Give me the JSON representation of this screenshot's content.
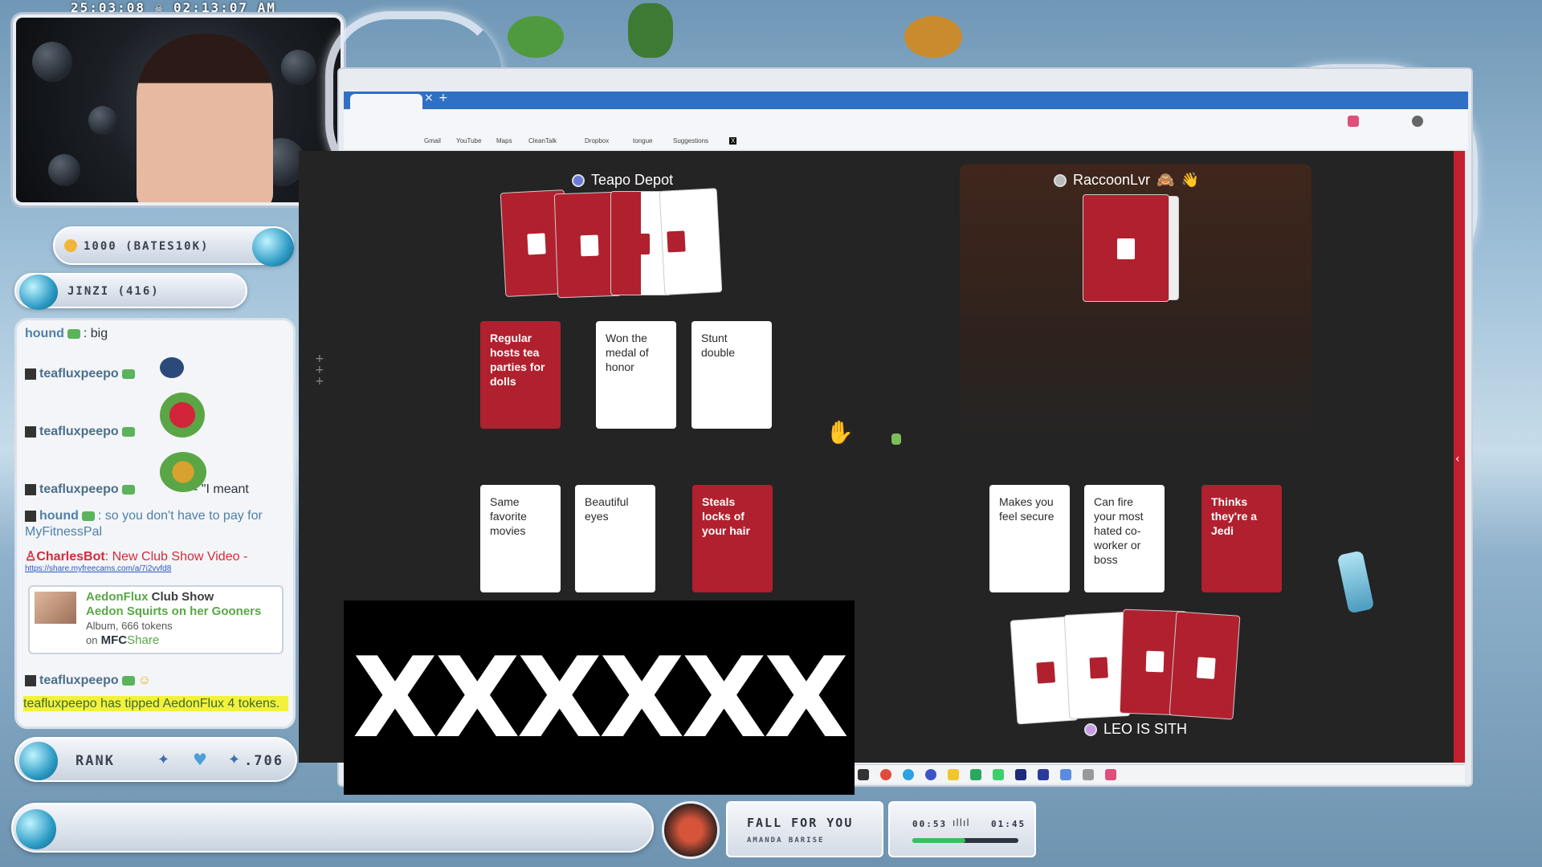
{
  "overlay": {
    "timestamp": "25:03:08 ☠ 02:13:07 AM",
    "goal_text": "1000 (BATES10K)",
    "viewer_text": "JINZI (416)",
    "rank_label": "RANK",
    "rank_value": ".706"
  },
  "chat": {
    "messages": [
      {
        "user": "hound",
        "text": ": big"
      },
      {
        "user": "teafluxpeepo",
        "text": ""
      },
      {
        "user": "teafluxpeepo",
        "text": ""
      },
      {
        "user": "teafluxpeepo",
        "text": "-- \"I meant"
      },
      {
        "user": "hound",
        "text": ": so you don't have to pay for MyFitnessPal"
      },
      {
        "user": "CharlesBot",
        "text": ": New Club Show Video -"
      }
    ],
    "link": "https://share.myfreecams.com/a/7i2vvfd8",
    "club_show": {
      "user": "AedonFlux",
      "label": "Club Show",
      "title": "Aedon Squirts on her Gooners",
      "album": "Album, 666 tokens",
      "on": "on",
      "brand1": "MFC",
      "brand2": "Share"
    },
    "last_user": "teafluxpeepo",
    "tip_text": "teafluxpeepo has tipped AedonFlux 4 tokens."
  },
  "browser": {
    "bookmarks": [
      "Gmail",
      "YouTube",
      "Maps",
      "CleanTalk",
      "Dropbox",
      "tongue",
      "Suggestions",
      "X"
    ]
  },
  "game": {
    "player1": {
      "name": "Teapo Depot"
    },
    "player2": {
      "name": "RaccoonLvr",
      "emoji1": "🙈",
      "emoji2": "👋"
    },
    "player3": {
      "name": "LEO IS SITH"
    },
    "top_cards": [
      {
        "text": "Regular hosts tea parties for dolls",
        "color": "red"
      },
      {
        "text": "Won the medal of honor",
        "color": "white"
      },
      {
        "text": "Stunt double",
        "color": "white"
      }
    ],
    "bottom_left_cards": [
      {
        "text": "Same favorite movies",
        "color": "white"
      },
      {
        "text": "Beautiful eyes",
        "color": "white"
      },
      {
        "text": "Steals locks of your hair",
        "color": "red"
      }
    ],
    "bottom_right_cards": [
      {
        "text": "Makes you feel secure",
        "color": "white"
      },
      {
        "text": "Can fire your most hated co-worker or boss",
        "color": "white"
      },
      {
        "text": "Thinks they're a Jedi",
        "color": "red"
      }
    ],
    "censor_text": "XXXXXX",
    "colors": {
      "red": "#b1202e",
      "table": "#242424",
      "accent": "#c2202e"
    }
  },
  "now_playing": {
    "title": "FALL FOR YOU",
    "artist": "AMANDA BARISE",
    "elapsed": "00:53",
    "total": "01:45",
    "progress": 0.5
  }
}
